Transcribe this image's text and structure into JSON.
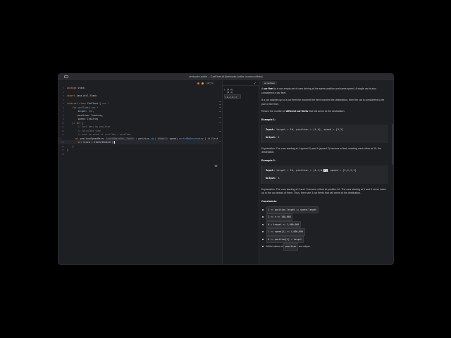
{
  "window": {
    "title": "leetcode-kotlin – CarFleet.kt [leetcode-kotlin.commonMain]"
  },
  "editor": {
    "lines": [
      {
        "n": "1",
        "html": "<span class='kw'>package</span> stack"
      },
      {
        "n": "2",
        "html": ""
      },
      {
        "n": "3",
        "html": "<span class='kw'>import</span> java.util.Stack"
      },
      {
        "n": "4",
        "html": ""
      },
      {
        "n": "5",
        "html": "<span class='kw'>internal class</span> CarFleet { <span class='cm'>new *</span>"
      },
      {
        "n": "6",
        "html": "    <span class='kw'>fun</span> <span class='fn'>carFleet</span>( <span class='cm'>new *</span>"
      },
      {
        "n": "7",
        "html": "        target: <span class='kw'>Int</span>,"
      },
      {
        "n": "8",
        "html": "        position: IntArray,"
      },
      {
        "n": "9",
        "html": "        speed: IntArray"
      },
      {
        "n": "10",
        "html": "    ): <span class='kw'>Int</span> {"
      },
      {
        "n": "11",
        "html": "        <span class='cm'>// Sort desc by position</span>"
      },
      {
        "n": "12",
        "html": "        <span class='cm'>// Calculate time</span>"
      },
      {
        "n": "13",
        "html": "        <span class='cm'>// push to stack if currTime > prevTime</span>"
      },
      {
        "n": "14",
        "html": "        <span class='kw'>val</span> positionSpeedPairs <span class='hint'>List&lt;Pair&lt;Int, Int&gt;&gt;</span> = position.<span class='fn'>zip</span>( <span class='hint'>other =</span> speed).<span class='fn'>sortedByDescending</span> { it.first }"
      },
      {
        "n": "15",
        "html": "        <span class='kw'>val</span> stack = Stack&lt;Double&gt;()<span class='cursor'></span>",
        "current": true
      },
      {
        "n": "16",
        "html": "    }"
      },
      {
        "n": "17",
        "html": "}"
      },
      {
        "n": "18",
        "html": ""
      }
    ],
    "badge": "47 ^ v"
  },
  "runpane": {
    "lines": [
      "[ [2,4]",
      "  [8,4]",
      "",
      "[4,4,0,1]"
    ],
    "box": "[4,4,0,1]"
  },
  "desc": {
    "tab_label": "CarFleet",
    "intro": [
      "A <b>car fleet</b> is a non-empty set of cars driving at the same position and same speed. A single car is also considered a car fleet.",
      "If a car catches up to a car fleet the moment the fleet reaches the destination, then the car is considered to be part of the fleet.",
      "Return the number of <b>different car fleets</b> that will arrive at the destination."
    ],
    "example1": {
      "heading": "Example 1:",
      "input_label": "Input:",
      "input_value": "target = 10, position = [1,4], speed = [3,2]",
      "output_label": "Output:",
      "output_value": "1",
      "explanation": "Explanation: The cars starting at 1 (speed 3) and 4 (speed 2) become a fleet, meeting each other at 10, the destination."
    },
    "example2": {
      "heading": "Example 2:",
      "input_label": "Input:",
      "input_value_pre": "target = 10, position = [4,1,0,",
      "input_value_hl": "7]",
      "input_value_post": ", speed = [2,2,1,1]",
      "output_label": "Output:",
      "output_value": "3",
      "explanation": "Explanation: The cars starting at 4 and 7 become a fleet at position 10. The cars starting at 1 and 0 never catch up to the car ahead of them. Thus, there are 3 car fleets that will arrive at the destination."
    },
    "constraints_heading": "Constraints:",
    "constraints": [
      "1 <= position.length == speed.length",
      "1 <= n <= 100,000",
      "0 < target <= 1,000,000",
      "1 <= speed[i] <= 1,000,000",
      "0 <= position[i] < target"
    ],
    "last_constraint_pre": "All the values of",
    "last_constraint_code": "position",
    "last_constraint_post": "are unique."
  }
}
